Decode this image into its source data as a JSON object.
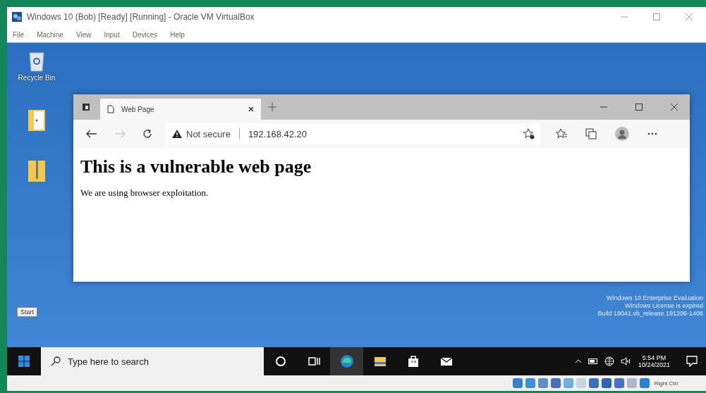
{
  "window": {
    "title": "Windows 10 (Bob) [Ready] [Running] - Oracle VM VirtualBox"
  },
  "menu": [
    "File",
    "Machine",
    "View",
    "Input",
    "Devices",
    "Help"
  ],
  "desktop_icons": [
    {
      "kind": "recycle",
      "label": "Recycle Bin"
    },
    {
      "kind": "folder"
    },
    {
      "kind": "zip"
    }
  ],
  "browser": {
    "tabs": [
      {
        "label": "Web Page",
        "selected": true
      }
    ],
    "security": "Not secure",
    "url": "192.168.42.20",
    "heading": "This is a vulnerable web page",
    "paragraph": "We are using browser exploitation."
  },
  "activation": [
    "Windows 10 Enterprise Evaluation",
    "Windows License is expired",
    "Build 19041.vb_release.191206-1406"
  ],
  "tooltip": "Start",
  "taskbar": {
    "search": {
      "placeholder": "Type here to search"
    },
    "apps": [
      {
        "kind": "cortana",
        "active": false
      },
      {
        "kind": "taskview",
        "active": false
      },
      {
        "kind": "edge",
        "active": true
      },
      {
        "kind": "explorer",
        "active": false
      },
      {
        "kind": "store",
        "active": false
      },
      {
        "kind": "mail",
        "active": false
      }
    ],
    "time": "5:54 PM",
    "date": "10/24/2021"
  },
  "status_bar": {
    "host_key": "Right Ctrl"
  }
}
